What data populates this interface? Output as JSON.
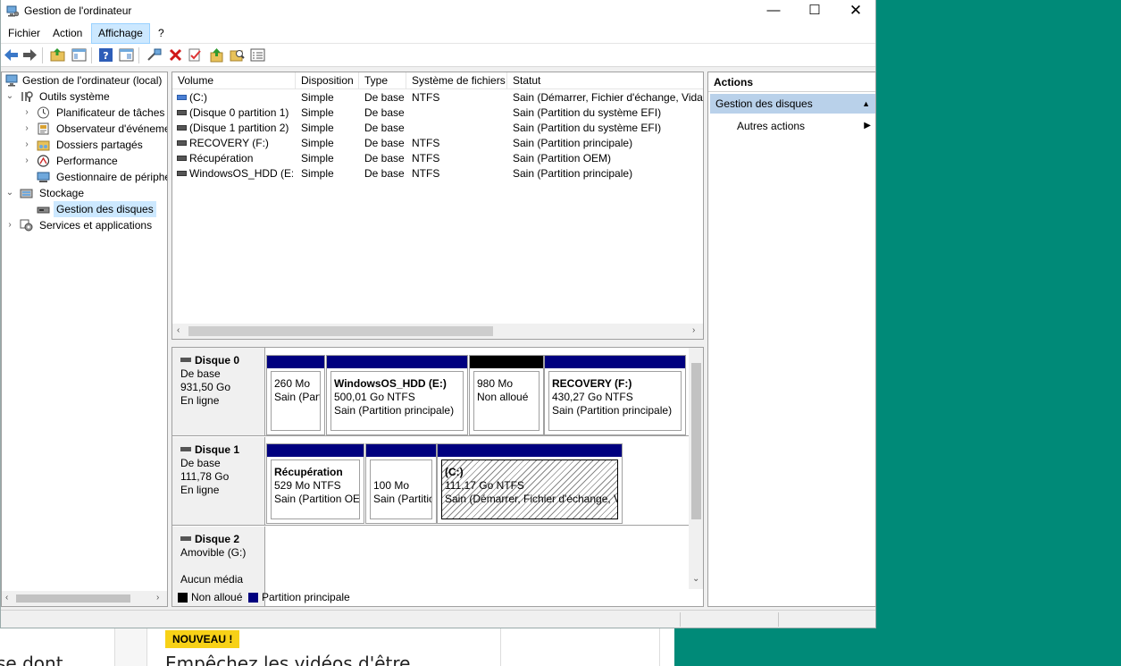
{
  "window": {
    "title": "Gestion de l'ordinateur",
    "minimize": "—",
    "maximize": "☐",
    "close": "✕"
  },
  "menu": {
    "items": [
      "Fichier",
      "Action",
      "Affichage",
      "?"
    ]
  },
  "tree": {
    "root": "Gestion de l'ordinateur (local)",
    "outils": "Outils système",
    "planificateur": "Planificateur de tâches",
    "observateur": "Observateur d'événeme",
    "dossiers": "Dossiers partagés",
    "performance": "Performance",
    "gestionnaire": "Gestionnaire de périphé",
    "stockage": "Stockage",
    "gestion_disques": "Gestion des disques",
    "services": "Services et applications"
  },
  "volume_list": {
    "columns": [
      "Volume",
      "Disposition",
      "Type",
      "Système de fichiers",
      "Statut"
    ],
    "rows": [
      {
        "volume": "(C:)",
        "disposition": "Simple",
        "type": "De base",
        "fs": "NTFS",
        "statut": "Sain (Démarrer, Fichier d'échange, Vidag"
      },
      {
        "volume": "(Disque 0 partition 1)",
        "disposition": "Simple",
        "type": "De base",
        "fs": "",
        "statut": "Sain (Partition du système EFI)"
      },
      {
        "volume": "(Disque 1 partition 2)",
        "disposition": "Simple",
        "type": "De base",
        "fs": "",
        "statut": "Sain (Partition du système EFI)"
      },
      {
        "volume": "RECOVERY (F:)",
        "disposition": "Simple",
        "type": "De base",
        "fs": "NTFS",
        "statut": "Sain (Partition principale)"
      },
      {
        "volume": "Récupération",
        "disposition": "Simple",
        "type": "De base",
        "fs": "NTFS",
        "statut": "Sain (Partition OEM)"
      },
      {
        "volume": "WindowsOS_HDD (E:)",
        "disposition": "Simple",
        "type": "De base",
        "fs": "NTFS",
        "statut": "Sain (Partition principale)"
      }
    ]
  },
  "disks": {
    "disk0": {
      "name": "Disque 0",
      "type": "De base",
      "size": "931,50 Go",
      "state": "En ligne",
      "p1": {
        "line1": "260 Mo",
        "line2": "Sain (Part"
      },
      "p2": {
        "name": "WindowsOS_HDD  (E:)",
        "line1": "500,01 Go NTFS",
        "line2": "Sain (Partition principale)"
      },
      "p3": {
        "line1": "980 Mo",
        "line2": "Non alloué"
      },
      "p4": {
        "name": "RECOVERY  (F:)",
        "line1": "430,27 Go NTFS",
        "line2": "Sain (Partition principale)"
      }
    },
    "disk1": {
      "name": "Disque 1",
      "type": "De base",
      "size": "111,78 Go",
      "state": "En ligne",
      "p1": {
        "name": "Récupération",
        "line1": "529 Mo NTFS",
        "line2": "Sain (Partition OEI"
      },
      "p2": {
        "line1": "100 Mo",
        "line2": "Sain (Partitic"
      },
      "p3": {
        "name": "(C:)",
        "line1": "111,17 Go NTFS",
        "line2": "Sain (Démarrer, Fichier d'échange, V"
      }
    },
    "disk2": {
      "name": "Disque 2",
      "type": "Amovible (G:)",
      "state": "Aucun média"
    }
  },
  "legend": {
    "unallocated": "Non alloué",
    "primary": "Partition principale",
    "unallocated_color": "#000000",
    "primary_color": "#00007f"
  },
  "actions": {
    "title": "Actions",
    "section": "Gestion des disques",
    "more": "Autres actions"
  },
  "background": {
    "badge": "NOUVEAU !",
    "text1": "se dont",
    "text2": "Empêchez les vidéos d'être"
  }
}
